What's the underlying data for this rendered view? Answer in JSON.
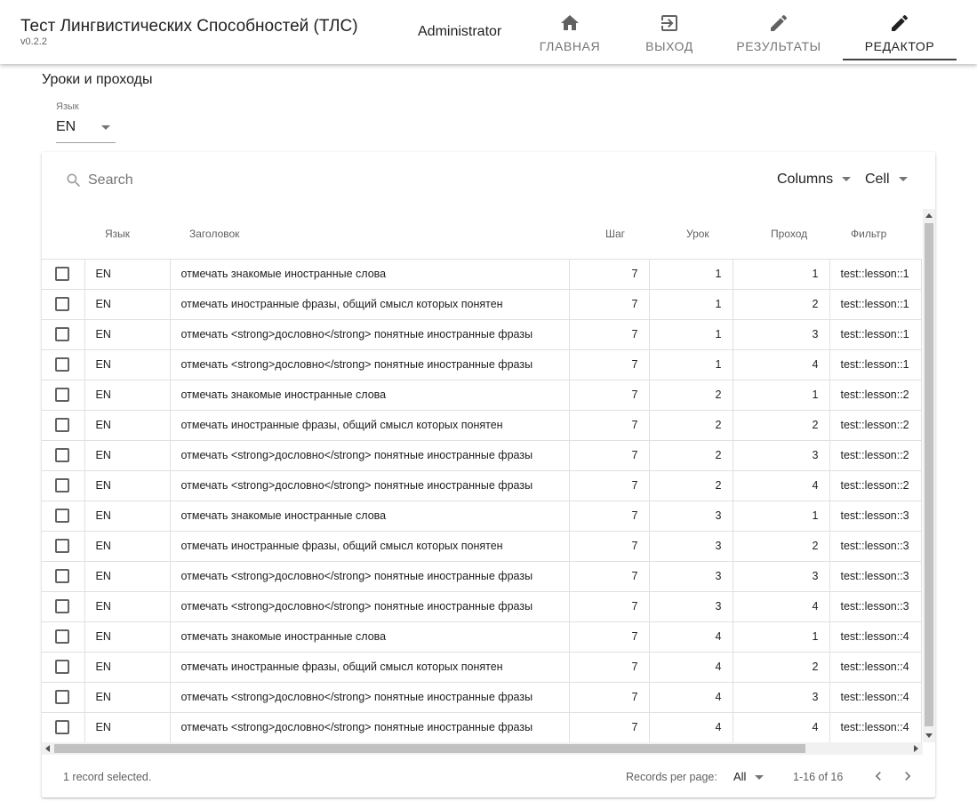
{
  "app": {
    "title": "Тест Лингвистических Способностей (ТЛС)",
    "version": "v0.2.2",
    "user": "Administrator"
  },
  "nav": {
    "home": {
      "label": "ГЛАВНАЯ",
      "icon": "home-icon"
    },
    "logout": {
      "label": "ВЫХОД",
      "icon": "exit-to-app-icon"
    },
    "results": {
      "label": "РЕЗУЛЬТАТЫ",
      "icon": "pencil-icon"
    },
    "editor": {
      "label": "РЕДАКТОР",
      "icon": "pencil-icon",
      "active": true
    }
  },
  "section": {
    "title": "Уроки и проходы"
  },
  "language_filter": {
    "label": "Язык",
    "value": "EN"
  },
  "toolbar": {
    "search_placeholder": "Search",
    "columns_label": "Columns",
    "cell_label": "Cell"
  },
  "table": {
    "headers": {
      "language": "Язык",
      "title": "Заголовок",
      "step": "Шаг",
      "lesson": "Урок",
      "pass": "Проход",
      "filter": "Фильтр"
    },
    "rows": [
      {
        "language": "EN",
        "title": "отмечать знакомые иностранные слова",
        "step": "7",
        "lesson": "1",
        "pass": "1",
        "filter": "test::lesson::1"
      },
      {
        "language": "EN",
        "title": "отмечать иностранные фразы, общий смысл которых понятен",
        "step": "7",
        "lesson": "1",
        "pass": "2",
        "filter": "test::lesson::1"
      },
      {
        "language": "EN",
        "title": "отмечать <strong>дословно</strong> понятные иностранные фразы",
        "step": "7",
        "lesson": "1",
        "pass": "3",
        "filter": "test::lesson::1"
      },
      {
        "language": "EN",
        "title": "отмечать <strong>дословно</strong> понятные иностранные фразы",
        "step": "7",
        "lesson": "1",
        "pass": "4",
        "filter": "test::lesson::1"
      },
      {
        "language": "EN",
        "title": "отмечать знакомые иностранные слова",
        "step": "7",
        "lesson": "2",
        "pass": "1",
        "filter": "test::lesson::2"
      },
      {
        "language": "EN",
        "title": "отмечать иностранные фразы, общий смысл которых понятен",
        "step": "7",
        "lesson": "2",
        "pass": "2",
        "filter": "test::lesson::2"
      },
      {
        "language": "EN",
        "title": "отмечать <strong>дословно</strong> понятные иностранные фразы",
        "step": "7",
        "lesson": "2",
        "pass": "3",
        "filter": "test::lesson::2"
      },
      {
        "language": "EN",
        "title": "отмечать <strong>дословно</strong> понятные иностранные фразы",
        "step": "7",
        "lesson": "2",
        "pass": "4",
        "filter": "test::lesson::2"
      },
      {
        "language": "EN",
        "title": "отмечать знакомые иностранные слова",
        "step": "7",
        "lesson": "3",
        "pass": "1",
        "filter": "test::lesson::3"
      },
      {
        "language": "EN",
        "title": "отмечать иностранные фразы, общий смысл которых понятен",
        "step": "7",
        "lesson": "3",
        "pass": "2",
        "filter": "test::lesson::3"
      },
      {
        "language": "EN",
        "title": "отмечать <strong>дословно</strong> понятные иностранные фразы",
        "step": "7",
        "lesson": "3",
        "pass": "3",
        "filter": "test::lesson::3"
      },
      {
        "language": "EN",
        "title": "отмечать <strong>дословно</strong> понятные иностранные фразы",
        "step": "7",
        "lesson": "3",
        "pass": "4",
        "filter": "test::lesson::3"
      },
      {
        "language": "EN",
        "title": "отмечать знакомые иностранные слова",
        "step": "7",
        "lesson": "4",
        "pass": "1",
        "filter": "test::lesson::4"
      },
      {
        "language": "EN",
        "title": "отмечать иностранные фразы, общий смысл которых понятен",
        "step": "7",
        "lesson": "4",
        "pass": "2",
        "filter": "test::lesson::4"
      },
      {
        "language": "EN",
        "title": "отмечать <strong>дословно</strong> понятные иностранные фразы",
        "step": "7",
        "lesson": "4",
        "pass": "3",
        "filter": "test::lesson::4"
      },
      {
        "language": "EN",
        "title": "отмечать <strong>дословно</strong> понятные иностранные фразы",
        "step": "7",
        "lesson": "4",
        "pass": "4",
        "filter": "test::lesson::4"
      }
    ]
  },
  "footer": {
    "selected_info": "1 record selected.",
    "records_per_page_label": "Records per page:",
    "records_per_page_value": "All",
    "range": "1-16 of 16"
  },
  "colors": {
    "primary_text": "#212121",
    "secondary_text": "#757575",
    "grid_border": "#e0e0e0",
    "active_tab_underline": "#424242"
  }
}
